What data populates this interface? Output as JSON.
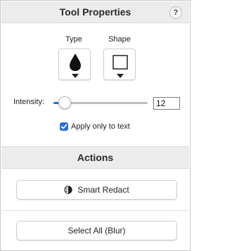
{
  "panel": {
    "title": "Tool Properties",
    "help_label": "?"
  },
  "type_picker": {
    "label": "Type",
    "icon": "drop-icon"
  },
  "shape_picker": {
    "label": "Shape",
    "icon": "square-icon"
  },
  "intensity": {
    "label": "Intensity:",
    "value": "12",
    "level_fraction": 0.12
  },
  "apply_only_text": {
    "label": "Apply only to text",
    "checked": true
  },
  "actions": {
    "title": "Actions",
    "smart_redact_label": "Smart Redact",
    "select_all_label": "Select All (Blur)"
  },
  "colors": {
    "accent": "#2c6fd1",
    "header_bg": "#ececec"
  }
}
